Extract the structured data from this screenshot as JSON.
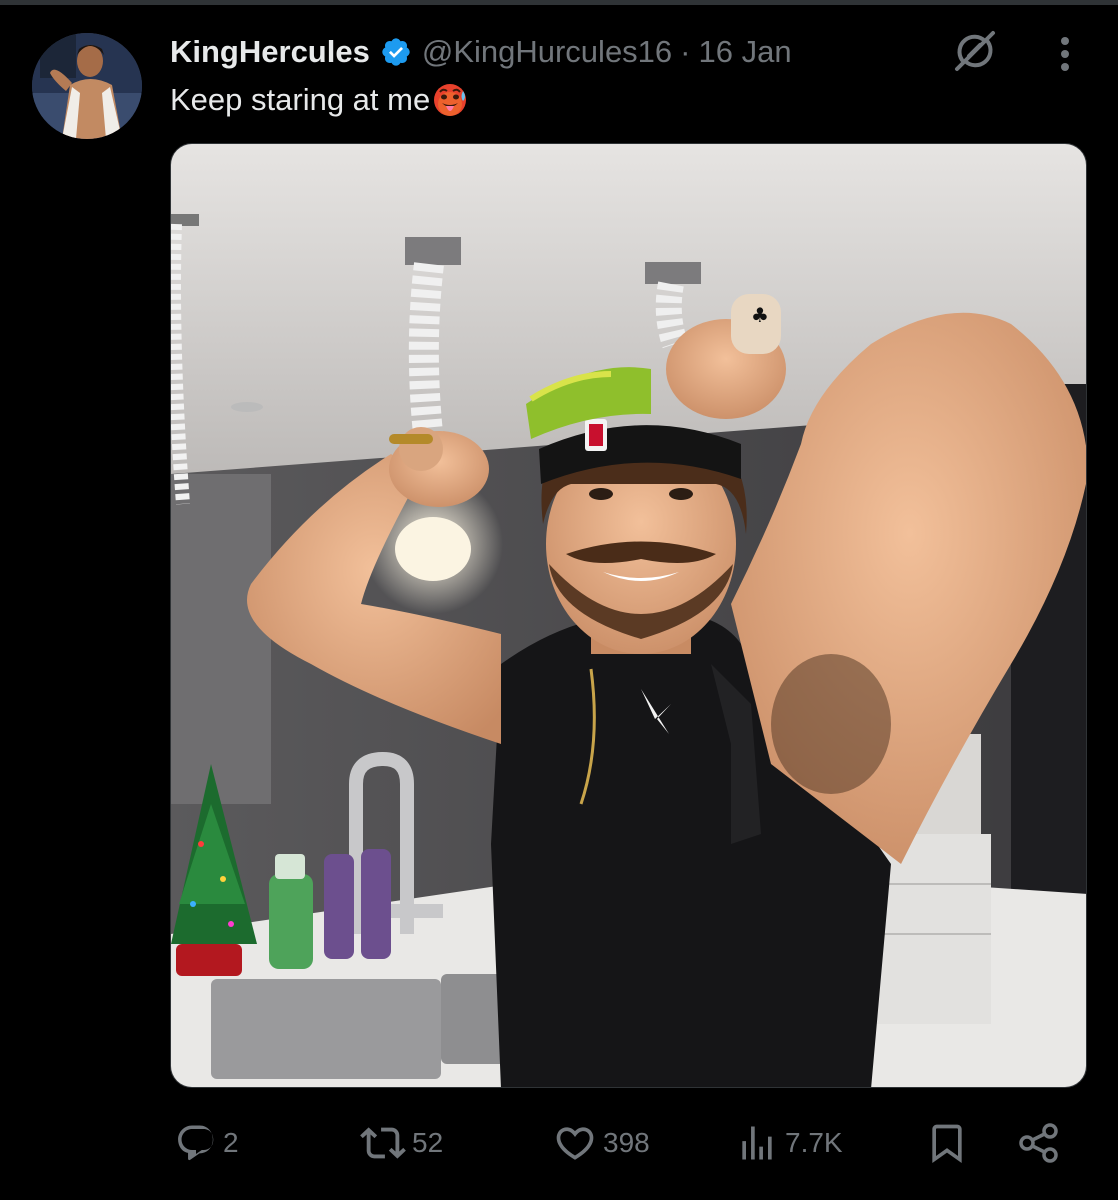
{
  "tweet": {
    "display_name": "KingHercules",
    "verified": true,
    "handle": "@KingHurcules16",
    "separator": "·",
    "date": "16 Jan",
    "text": "Keep staring at me"
  },
  "actions": {
    "replies": "2",
    "reposts": "52",
    "likes": "398",
    "views": "7.7K"
  },
  "colors": {
    "background": "#000000",
    "primary_text": "#e7e9ea",
    "secondary_text": "#71767b",
    "verified_badge": "#1d9bf0"
  },
  "icons": [
    "verified-badge-icon",
    "grok-icon",
    "more-icon",
    "reply-icon",
    "repost-icon",
    "like-icon",
    "views-icon",
    "bookmark-icon",
    "share-icon",
    "hot-face-emoji"
  ]
}
